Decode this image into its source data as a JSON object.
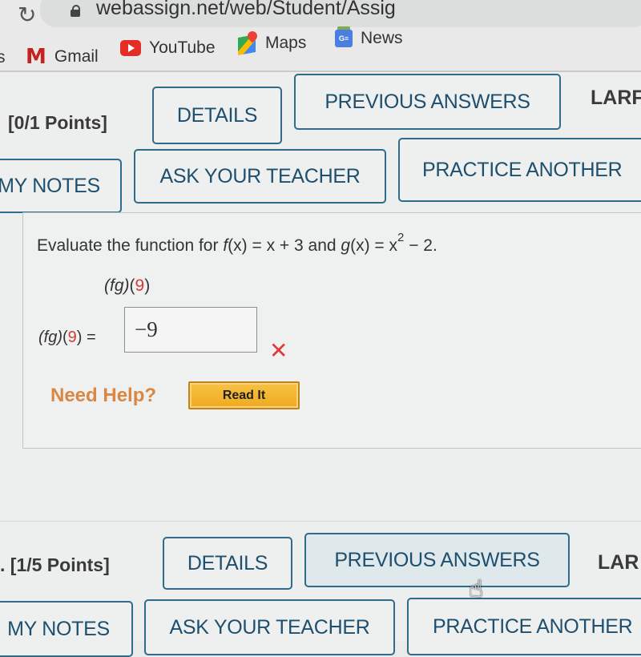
{
  "browser": {
    "url": "webassign.net/web/Student/Assig",
    "bookmarks": [
      {
        "label": "Gmail",
        "icon": "gmail-icon"
      },
      {
        "label": "YouTube",
        "icon": "youtube-icon"
      },
      {
        "label": "Maps",
        "icon": "maps-icon"
      },
      {
        "label": "News",
        "icon": "news-icon"
      }
    ],
    "partial_left_label": "s"
  },
  "question1": {
    "points": "[0/1 Points]",
    "buttons": {
      "details": "DETAILS",
      "previous_answers": "PREVIOUS ANSWERS",
      "my_notes": "MY NOTES",
      "ask_teacher": "ASK YOUR TEACHER",
      "practice_another": "PRACTICE ANOTHER"
    },
    "source_label": "LARF",
    "prompt": {
      "lead": "Evaluate the function for ",
      "f_name": "f",
      "f_def": "(x) = x + 3 and ",
      "g_name": "g",
      "g_def": "(x) = x",
      "exp": "2",
      "tail": " − 2."
    },
    "expression": {
      "func": "(fg)",
      "open": "(",
      "arg": "9",
      "close": ")"
    },
    "answer_label": {
      "func": "(fg)",
      "open": "(",
      "arg": "9",
      "close": ") ="
    },
    "answer_value": "−9",
    "status": "incorrect",
    "status_mark": "✕",
    "need_help": "Need Help?",
    "read_it": "Read It"
  },
  "question2": {
    "points": ". [1/5 Points]",
    "buttons": {
      "details": "DETAILS",
      "previous_answers": "PREVIOUS ANSWERS",
      "my_notes": "MY NOTES",
      "ask_teacher": "ASK YOUR TEACHER",
      "practice_another": "PRACTICE ANOTHER"
    },
    "source_label": "LAR"
  },
  "colors": {
    "button_border": "#2f6b8a",
    "button_text": "#1f4f6e",
    "incorrect": "#e03a3a",
    "need_help": "#d98743",
    "read_it_bg": "#f0b02c"
  }
}
